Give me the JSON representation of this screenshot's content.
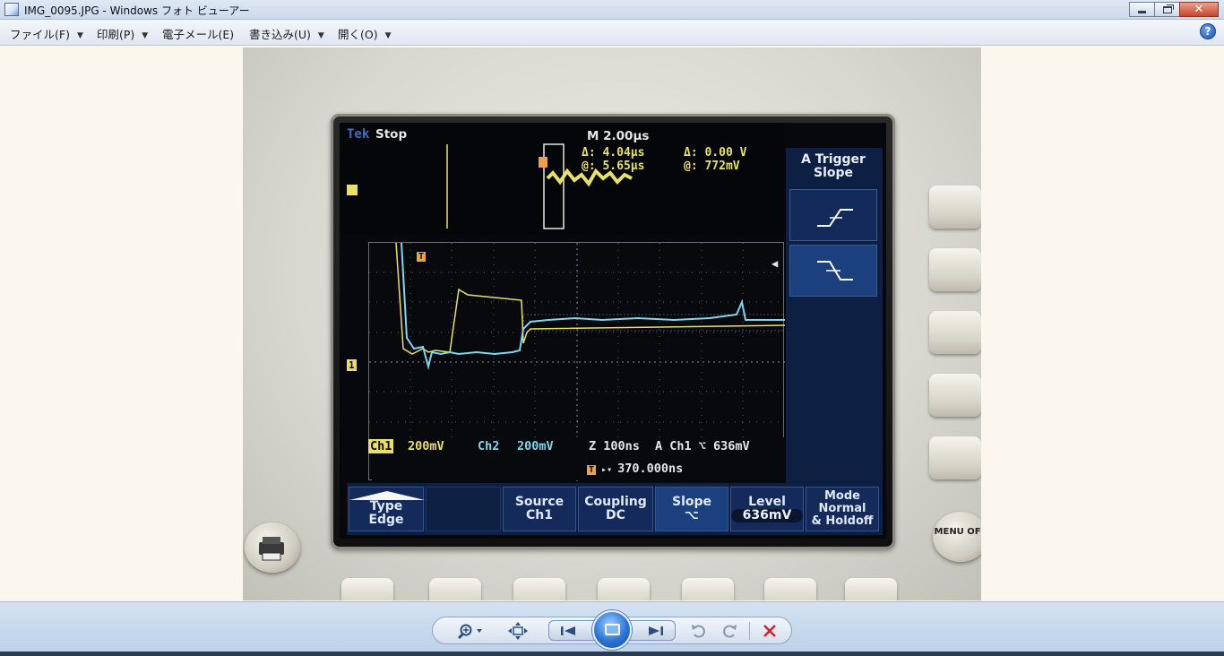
{
  "window": {
    "title": "IMG_0095.JPG - Windows フォト ビューアー"
  },
  "menu": {
    "items": [
      {
        "label": "ファイル(F)",
        "has_arrow": true
      },
      {
        "label": "印刷(P)",
        "has_arrow": true
      },
      {
        "label": "電子メール(E)",
        "has_arrow": false
      },
      {
        "label": "書き込み(U)",
        "has_arrow": true
      },
      {
        "label": "開く(O)",
        "has_arrow": true
      }
    ],
    "help_label": "?"
  },
  "scope": {
    "brand": "Tek",
    "state": "Stop",
    "timebase": "M 2.00µs",
    "cursor": {
      "delta_time": "Δ:   4.04µs",
      "at_time": "@:   5.65µs",
      "delta_volt": "Δ:   0.00 V",
      "at_volt": "@:  772mV"
    },
    "right_menu": {
      "title": "A Trigger Slope"
    },
    "readout": {
      "ch1_label": "Ch1",
      "ch1_value": "200mV",
      "ch2_label": "Ch2",
      "ch2_value": "200mV",
      "zoom": "Z 100ns",
      "trig": "A  Ch1  ⌥  636mV",
      "trig_pos": "370.000ns"
    },
    "bottom_menu": [
      {
        "line1": "Type",
        "line2": "Edge"
      },
      {
        "line1": "",
        "line2": ""
      },
      {
        "line1": "Source",
        "line2": "Ch1"
      },
      {
        "line1": "Coupling",
        "line2": "DC"
      },
      {
        "line1": "Slope",
        "line2": "⌥"
      },
      {
        "line1": "Level",
        "line2": "636mV"
      },
      {
        "line1": "Mode",
        "line2": "Normal",
        "line3": "& Holdoff"
      }
    ],
    "menu_off_label": "MENU OFF",
    "colors": {
      "ch1": "#e8e06a",
      "ch2": "#7fd6ee",
      "menu": "#132a5a"
    }
  },
  "toolbar": {
    "zoom_icon": "magnifier-icon",
    "fit_icon": "actual-size-icon",
    "prev_icon": "previous-icon",
    "slideshow_icon": "slideshow-icon",
    "next_icon": "next-icon",
    "rotate_left_icon": "rotate-ccw-icon",
    "rotate_right_icon": "rotate-cw-icon",
    "delete_icon": "delete-icon"
  }
}
